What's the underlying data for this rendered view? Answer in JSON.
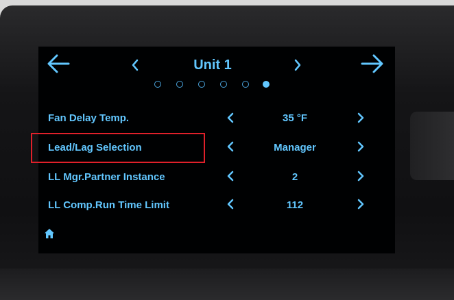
{
  "header": {
    "title": "Unit 1",
    "back_icon": "arrow-left-icon",
    "forward_icon": "arrow-right-icon",
    "prev_icon": "chevron-left-icon",
    "next_icon": "chevron-right-icon"
  },
  "pager": {
    "total_pages": 6,
    "current_page": 6
  },
  "settings": [
    {
      "label": "Fan Delay Temp.",
      "value": "35 °F"
    },
    {
      "label": "Lead/Lag Selection",
      "value": "Manager",
      "highlighted": true
    },
    {
      "label": "LL Mgr.Partner Instance",
      "value": "2"
    },
    {
      "label": "LL Comp.Run Time Limit",
      "value": "112"
    }
  ],
  "footer": {
    "home_icon": "home-icon"
  },
  "colors": {
    "accent": "#62c7ff",
    "highlight_border": "#e0202a",
    "screen_bg": "#000102"
  }
}
